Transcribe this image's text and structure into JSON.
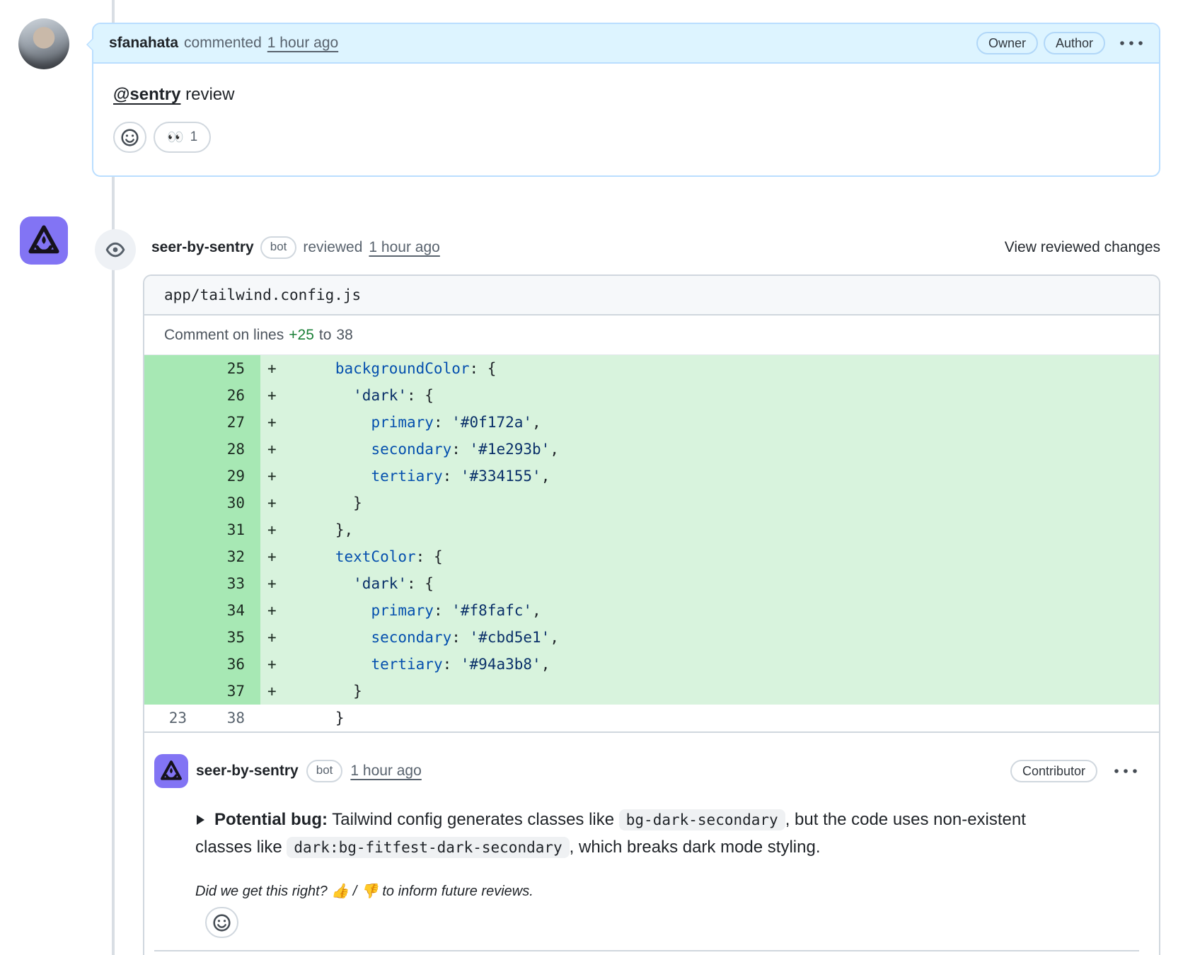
{
  "colors": {
    "header-blue": "#ddf4ff",
    "blue-border": "#badeff",
    "border-gray": "#d0d7de",
    "muted": "#59636e",
    "text": "#1f2328",
    "link-green": "#1a7f37",
    "add-line-bg": "#d8f3dd",
    "add-num-bg": "#a7e8b4",
    "code-key": "#0550ae",
    "code-string": "#0a3069",
    "seer-purple": "#8274f4",
    "chip-bg": "#eff1f3"
  },
  "icons": {
    "smiley-icon": "add-reaction smiley",
    "eye-reviewed-icon": "eye octicon",
    "kebab-icon": "horizontal three dots",
    "collapse-triangle-icon": "right-pointing disclosure triangle",
    "seer-logo-icon": "pyramid with eye"
  },
  "comment1": {
    "author": "sfanahata",
    "action": "commented",
    "time": "1 hour ago",
    "badges": [
      "Owner",
      "Author"
    ],
    "mention": "@sentry",
    "mention_rest": " review",
    "reactions": {
      "emoji": "👀",
      "count": "1"
    }
  },
  "review": {
    "author": "seer-by-sentry",
    "bot_label": "bot",
    "action": "reviewed",
    "time": "1 hour ago",
    "view_link": "View reviewed changes",
    "file": "app/tailwind.config.js",
    "range": {
      "prefix": "Comment on lines",
      "added": "+25",
      "middle": "to",
      "end": "38"
    },
    "diff": {
      "lines": [
        {
          "old": "",
          "new": "25",
          "sign": "+",
          "type": "add",
          "code": [
            {
              "c": "p",
              "t": "      "
            },
            {
              "c": "k",
              "t": "backgroundColor"
            },
            {
              "c": "p",
              "t": ": {"
            }
          ]
        },
        {
          "old": "",
          "new": "26",
          "sign": "+",
          "type": "add",
          "code": [
            {
              "c": "p",
              "t": "        "
            },
            {
              "c": "s",
              "t": "'dark'"
            },
            {
              "c": "p",
              "t": ": {"
            }
          ]
        },
        {
          "old": "",
          "new": "27",
          "sign": "+",
          "type": "add",
          "code": [
            {
              "c": "p",
              "t": "          "
            },
            {
              "c": "k",
              "t": "primary"
            },
            {
              "c": "p",
              "t": ": "
            },
            {
              "c": "s",
              "t": "'#0f172a'"
            },
            {
              "c": "p",
              "t": ","
            }
          ]
        },
        {
          "old": "",
          "new": "28",
          "sign": "+",
          "type": "add",
          "code": [
            {
              "c": "p",
              "t": "          "
            },
            {
              "c": "k",
              "t": "secondary"
            },
            {
              "c": "p",
              "t": ": "
            },
            {
              "c": "s",
              "t": "'#1e293b'"
            },
            {
              "c": "p",
              "t": ","
            }
          ]
        },
        {
          "old": "",
          "new": "29",
          "sign": "+",
          "type": "add",
          "code": [
            {
              "c": "p",
              "t": "          "
            },
            {
              "c": "k",
              "t": "tertiary"
            },
            {
              "c": "p",
              "t": ": "
            },
            {
              "c": "s",
              "t": "'#334155'"
            },
            {
              "c": "p",
              "t": ","
            }
          ]
        },
        {
          "old": "",
          "new": "30",
          "sign": "+",
          "type": "add",
          "code": [
            {
              "c": "p",
              "t": "        }"
            }
          ]
        },
        {
          "old": "",
          "new": "31",
          "sign": "+",
          "type": "add",
          "code": [
            {
              "c": "p",
              "t": "      },"
            }
          ]
        },
        {
          "old": "",
          "new": "32",
          "sign": "+",
          "type": "add",
          "code": [
            {
              "c": "p",
              "t": "      "
            },
            {
              "c": "k",
              "t": "textColor"
            },
            {
              "c": "p",
              "t": ": {"
            }
          ]
        },
        {
          "old": "",
          "new": "33",
          "sign": "+",
          "type": "add",
          "code": [
            {
              "c": "p",
              "t": "        "
            },
            {
              "c": "s",
              "t": "'dark'"
            },
            {
              "c": "p",
              "t": ": {"
            }
          ]
        },
        {
          "old": "",
          "new": "34",
          "sign": "+",
          "type": "add",
          "code": [
            {
              "c": "p",
              "t": "          "
            },
            {
              "c": "k",
              "t": "primary"
            },
            {
              "c": "p",
              "t": ": "
            },
            {
              "c": "s",
              "t": "'#f8fafc'"
            },
            {
              "c": "p",
              "t": ","
            }
          ]
        },
        {
          "old": "",
          "new": "35",
          "sign": "+",
          "type": "add",
          "code": [
            {
              "c": "p",
              "t": "          "
            },
            {
              "c": "k",
              "t": "secondary"
            },
            {
              "c": "p",
              "t": ": "
            },
            {
              "c": "s",
              "t": "'#cbd5e1'"
            },
            {
              "c": "p",
              "t": ","
            }
          ]
        },
        {
          "old": "",
          "new": "36",
          "sign": "+",
          "type": "add",
          "code": [
            {
              "c": "p",
              "t": "          "
            },
            {
              "c": "k",
              "t": "tertiary"
            },
            {
              "c": "p",
              "t": ": "
            },
            {
              "c": "s",
              "t": "'#94a3b8'"
            },
            {
              "c": "p",
              "t": ","
            }
          ]
        },
        {
          "old": "",
          "new": "37",
          "sign": "+",
          "type": "add",
          "code": [
            {
              "c": "p",
              "t": "        }"
            }
          ]
        },
        {
          "old": "23",
          "new": "38",
          "sign": "",
          "type": "ctx",
          "code": [
            {
              "c": "p",
              "t": "      }"
            }
          ]
        }
      ]
    }
  },
  "comment2": {
    "author": "seer-by-sentry",
    "bot_label": "bot",
    "time": "1 hour ago",
    "badge": "Contributor",
    "body": [
      {
        "c": "b",
        "t": "Potential bug:"
      },
      {
        "c": "t",
        "t": " Tailwind config generates classes like "
      },
      {
        "c": "code",
        "t": "bg-dark-secondary"
      },
      {
        "c": "t",
        "t": ", but the code uses non-existent classes like "
      },
      {
        "c": "code",
        "t": "dark:bg-fitfest-dark-secondary"
      },
      {
        "c": "t",
        "t": ", which breaks dark mode styling."
      }
    ],
    "footer": "Did we get this right? 👍 / 👎 to inform future reviews."
  }
}
